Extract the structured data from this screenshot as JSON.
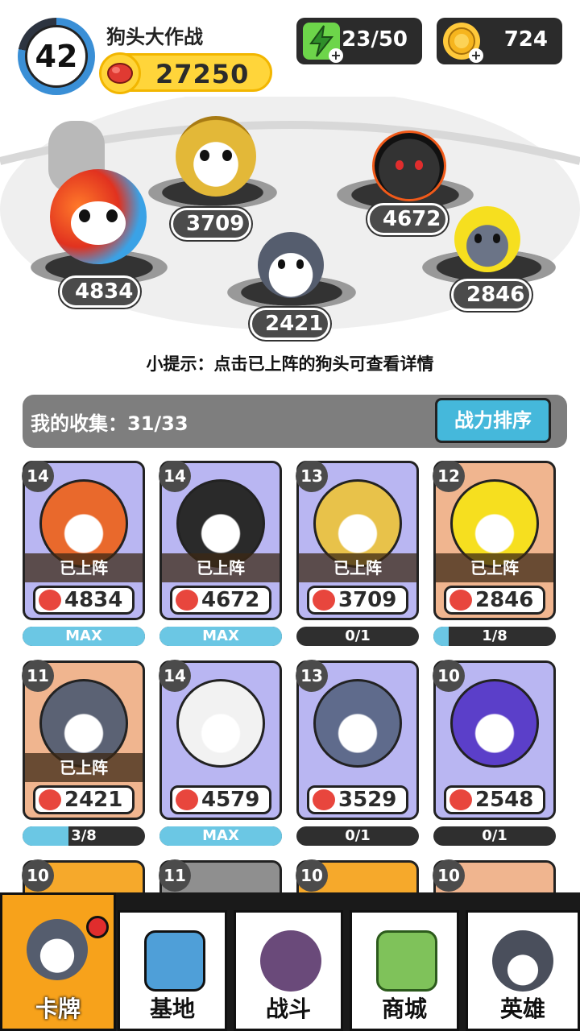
{
  "header": {
    "level": "42",
    "title": "狗头大作战",
    "total_power": "27250",
    "energy": "23/50",
    "coins": "724"
  },
  "field": {
    "dogs": [
      {
        "name": "fire-ice-dog",
        "power": "4834"
      },
      {
        "name": "golden-armor-dog",
        "power": "3709"
      },
      {
        "name": "baby-dog",
        "power": "2421"
      },
      {
        "name": "bomb-dog",
        "power": "4672"
      },
      {
        "name": "crying-lemon-dog",
        "power": "2846"
      }
    ],
    "tip": "小提示：点击已上阵的狗头可查看详情"
  },
  "collection": {
    "label": "我的收集：31/33",
    "sort_button": "战力排序",
    "deployed_label": "已上阵",
    "cards": [
      {
        "level": "14",
        "power": "4834",
        "progress": "MAX",
        "fill": 1.0,
        "deployed": true,
        "frame": "purple",
        "color": "#e9692c"
      },
      {
        "level": "14",
        "power": "4672",
        "progress": "MAX",
        "fill": 1.0,
        "deployed": true,
        "frame": "purple",
        "color": "#2a2a2a"
      },
      {
        "level": "13",
        "power": "3709",
        "progress": "0/1",
        "fill": 0.0,
        "deployed": true,
        "frame": "purple",
        "color": "#e8c24a"
      },
      {
        "level": "12",
        "power": "2846",
        "progress": "1/8",
        "fill": 0.125,
        "deployed": true,
        "frame": "orange",
        "color": "#f6df1f"
      },
      {
        "level": "11",
        "power": "2421",
        "progress": "3/8",
        "fill": 0.375,
        "deployed": true,
        "frame": "orange",
        "color": "#5b6274"
      },
      {
        "level": "14",
        "power": "4579",
        "progress": "MAX",
        "fill": 1.0,
        "deployed": false,
        "frame": "purple",
        "color": "#f2f2f2"
      },
      {
        "level": "13",
        "power": "3529",
        "progress": "0/1",
        "fill": 0.0,
        "deployed": false,
        "frame": "purple",
        "color": "#5f6b8c"
      },
      {
        "level": "10",
        "power": "2548",
        "progress": "0/1",
        "fill": 0.0,
        "deployed": false,
        "frame": "purple",
        "color": "#5b3fc9"
      }
    ],
    "next_row_levels": [
      "10",
      "11",
      "10",
      "10"
    ]
  },
  "nav": {
    "tabs": [
      "卡牌",
      "基地",
      "战斗",
      "商城",
      "英雄"
    ]
  },
  "colors": {
    "accent_orange": "#f7a21b",
    "sort_button": "#45b8db",
    "power_pill": "#ffd53a"
  }
}
